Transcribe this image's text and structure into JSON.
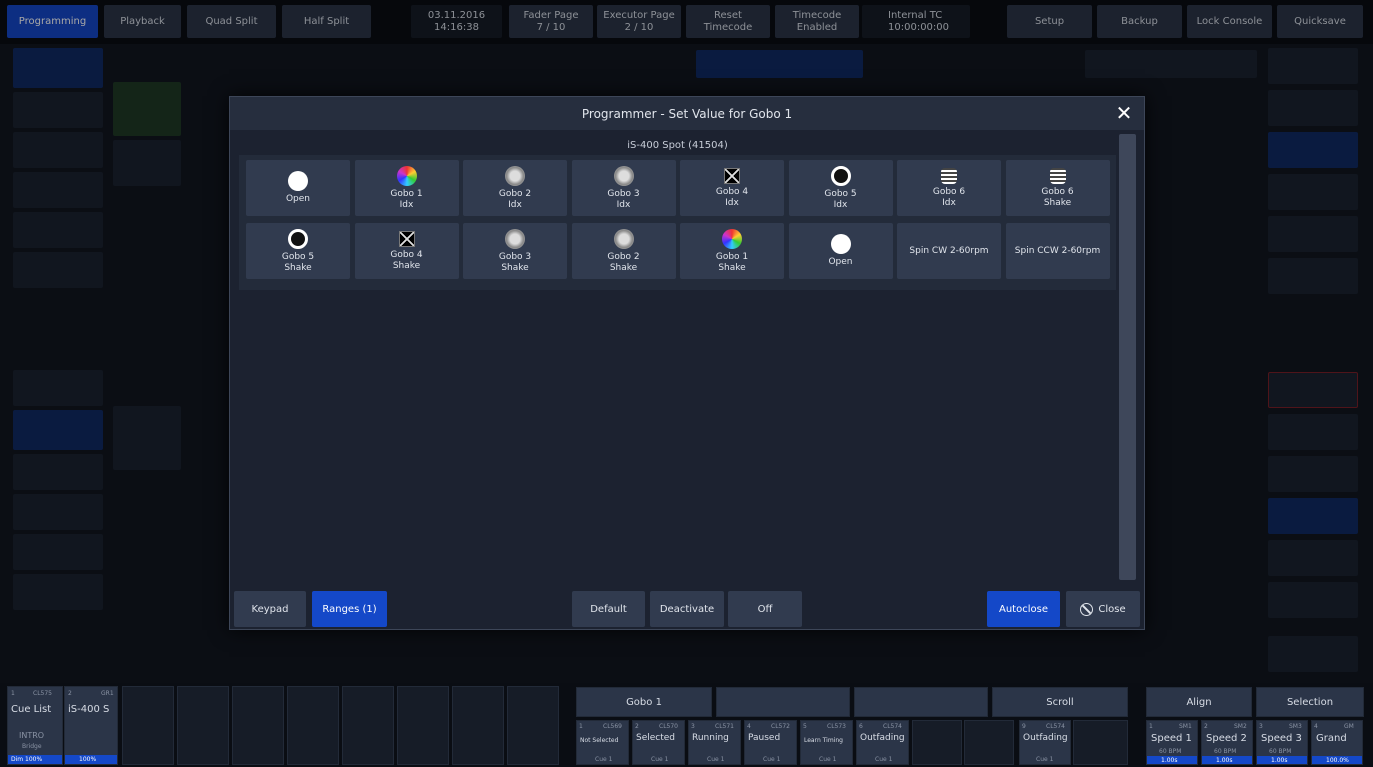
{
  "topbar": [
    {
      "label": "Programming",
      "active": true
    },
    {
      "label": "Playback"
    },
    {
      "label": "Quad Split"
    },
    {
      "label": "Half Split"
    },
    {
      "line1": "03.11.2016",
      "line2": "14:16:38"
    },
    {
      "line1": "Fader Page",
      "line2": "7 / 10"
    },
    {
      "line1": "Executor Page",
      "line2": "2 / 10"
    },
    {
      "line1": "Reset",
      "line2": "Timecode"
    },
    {
      "line1": "Timecode",
      "line2": "Enabled"
    },
    {
      "line1": "Internal TC",
      "line2": "10:00:00:00"
    },
    {
      "label": "Setup"
    },
    {
      "label": "Backup"
    },
    {
      "label": "Lock Console"
    },
    {
      "label": "Quicksave"
    }
  ],
  "modal": {
    "title": "Programmer - Set Value for Gobo 1",
    "fixture_header": "iS-400 Spot (41504)",
    "cells": [
      {
        "l1": "Open",
        "l2": "",
        "icon": "open-gobo-icon"
      },
      {
        "l1": "Gobo 1",
        "l2": "Idx",
        "icon": "color-gobo-icon"
      },
      {
        "l1": "Gobo 2",
        "l2": "Idx",
        "icon": "texture-gobo-icon"
      },
      {
        "l1": "Gobo 3",
        "l2": "Idx",
        "icon": "texture-gobo-icon"
      },
      {
        "l1": "Gobo 4",
        "l2": "Idx",
        "icon": "star-gobo-icon"
      },
      {
        "l1": "Gobo 5",
        "l2": "Idx",
        "icon": "ring-gobo-icon"
      },
      {
        "l1": "Gobo 6",
        "l2": "Idx",
        "icon": "stripe-gobo-icon"
      },
      {
        "l1": "Gobo 6",
        "l2": "Shake",
        "icon": "stripe-gobo-icon"
      },
      {
        "l1": "Gobo 5",
        "l2": "Shake",
        "icon": "ring-gobo-icon"
      },
      {
        "l1": "Gobo 4",
        "l2": "Shake",
        "icon": "star-gobo-icon"
      },
      {
        "l1": "Gobo 3",
        "l2": "Shake",
        "icon": "texture-gobo-icon"
      },
      {
        "l1": "Gobo 2",
        "l2": "Shake",
        "icon": "texture-gobo-icon"
      },
      {
        "l1": "Gobo 1",
        "l2": "Shake",
        "icon": "color-gobo-icon"
      },
      {
        "l1": "Open",
        "l2": "",
        "icon": "open-gobo-icon"
      },
      {
        "l1": "Spin CW 2-60rpm",
        "l2": "",
        "icon": ""
      },
      {
        "l1": "Spin CCW 2-60rpm",
        "l2": "",
        "icon": ""
      }
    ],
    "buttons": {
      "keypad": "Keypad",
      "ranges": "Ranges (1)",
      "default": "Default",
      "deactivate": "Deactivate",
      "off": "Off",
      "autoclose": "Autoclose",
      "close": "Close"
    }
  },
  "bottom": {
    "cuelist_num1": "1",
    "cuelist_id1": "CL575",
    "cuelist_num2": "2",
    "cuelist_id2": "GR1",
    "cuelist_title": "Cue List",
    "group_title": "iS-400 S",
    "cuelist_status": "INTRO",
    "cuelist_sub": "Bridge",
    "cuelist_dim": "Dim 100%",
    "group_level": "100%",
    "gobo_label": "Gobo 1",
    "scroll_label": "Scroll",
    "align_label": "Align",
    "selection_label": "Selection",
    "playbacks": [
      {
        "n": "1",
        "id": "CL569",
        "label": "Not Selected",
        "cue": "Cue 1"
      },
      {
        "n": "2",
        "id": "CL570",
        "label": "Selected",
        "cue": "Cue 1"
      },
      {
        "n": "3",
        "id": "CL571",
        "label": "Running",
        "cue": "Cue 1"
      },
      {
        "n": "4",
        "id": "CL572",
        "label": "Paused",
        "cue": "Cue 1"
      },
      {
        "n": "5",
        "id": "CL573",
        "label": "Learn Timing",
        "cue": "Cue 1"
      },
      {
        "n": "6",
        "id": "CL574",
        "label": "Outfading",
        "cue": "Cue 1"
      }
    ],
    "pb9": {
      "n": "9",
      "id": "CL574",
      "label": "Outfading",
      "cue": "Cue 1"
    },
    "speeds": [
      {
        "n": "1",
        "id": "SM1",
        "label": "Speed 1",
        "bpm": "60 BPM",
        "val": "1.00s"
      },
      {
        "n": "2",
        "id": "SM2",
        "label": "Speed 2",
        "bpm": "60 BPM",
        "val": "1.00s"
      },
      {
        "n": "3",
        "id": "SM3",
        "label": "Speed 3",
        "bpm": "60 BPM",
        "val": "1.00s"
      },
      {
        "n": "4",
        "id": "GM",
        "label": "Grand",
        "bpm": "",
        "val": "100.0%"
      }
    ]
  }
}
